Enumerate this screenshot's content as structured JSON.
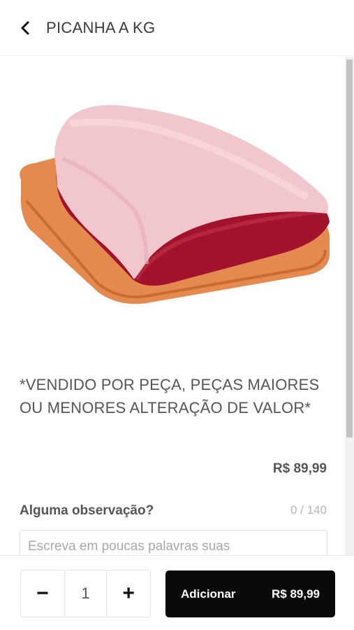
{
  "header": {
    "title": "PICANHA A KG"
  },
  "product": {
    "description": "*VENDIDO POR PEÇA, PEÇAS MAIORES OU MENORES ALTERAÇÃO DE VALOR*",
    "price": "R$ 89,99"
  },
  "observation": {
    "label": "Alguma observação?",
    "counter": "0 / 140",
    "placeholder": "Escreva em poucas palavras suas"
  },
  "footer": {
    "minus_label": "−",
    "quantity": "1",
    "plus_label": "+",
    "add_label": "Adicionar",
    "add_price": "R$ 89,99"
  },
  "icons": {
    "back": "chevron-left-icon"
  }
}
